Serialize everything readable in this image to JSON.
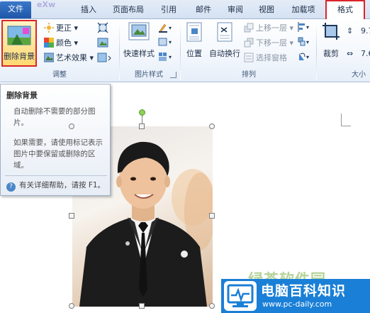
{
  "tabs": {
    "file": "文件",
    "logo_fragment": "eXw",
    "items": [
      "插入",
      "页面布局",
      "引用",
      "邮件",
      "审阅",
      "视图",
      "加载项"
    ],
    "active": "格式"
  },
  "ribbon": {
    "remove_background": "删除背景",
    "adjust": {
      "corrections": "更正",
      "color": "颜色",
      "artistic": "艺术效果",
      "group_label": "调整"
    },
    "picture_styles": {
      "quick_styles": "快速样式",
      "group_label": "图片样式"
    },
    "arrange": {
      "position": "位置",
      "wrap_text": "自动换行",
      "bring_forward": "上移一层",
      "send_backward": "下移一层",
      "selection_pane": "选择窗格",
      "group_label": "排列"
    },
    "size": {
      "crop": "裁剪",
      "height": "9.7",
      "width": "7.6",
      "group_label": "大小"
    }
  },
  "tooltip": {
    "title": "删除背景",
    "para1_line1": "自动删除不需要的部分图",
    "para1_line2": "片。",
    "para2_line1": "如果需要，请使用标记表示",
    "para2_line2": "图片中要保留或删除的区",
    "para2_line3": "域。",
    "help": "有关详细帮助，请按 F1。"
  },
  "watermark": {
    "faded_text": "绿茶软件园",
    "title": "电脑百科知识",
    "url": "www.pc-daily.com"
  },
  "colors": {
    "highlight_border": "#d8262a",
    "watermark_blue": "#1a7fd6",
    "rotation_handle": "#8fd055"
  }
}
